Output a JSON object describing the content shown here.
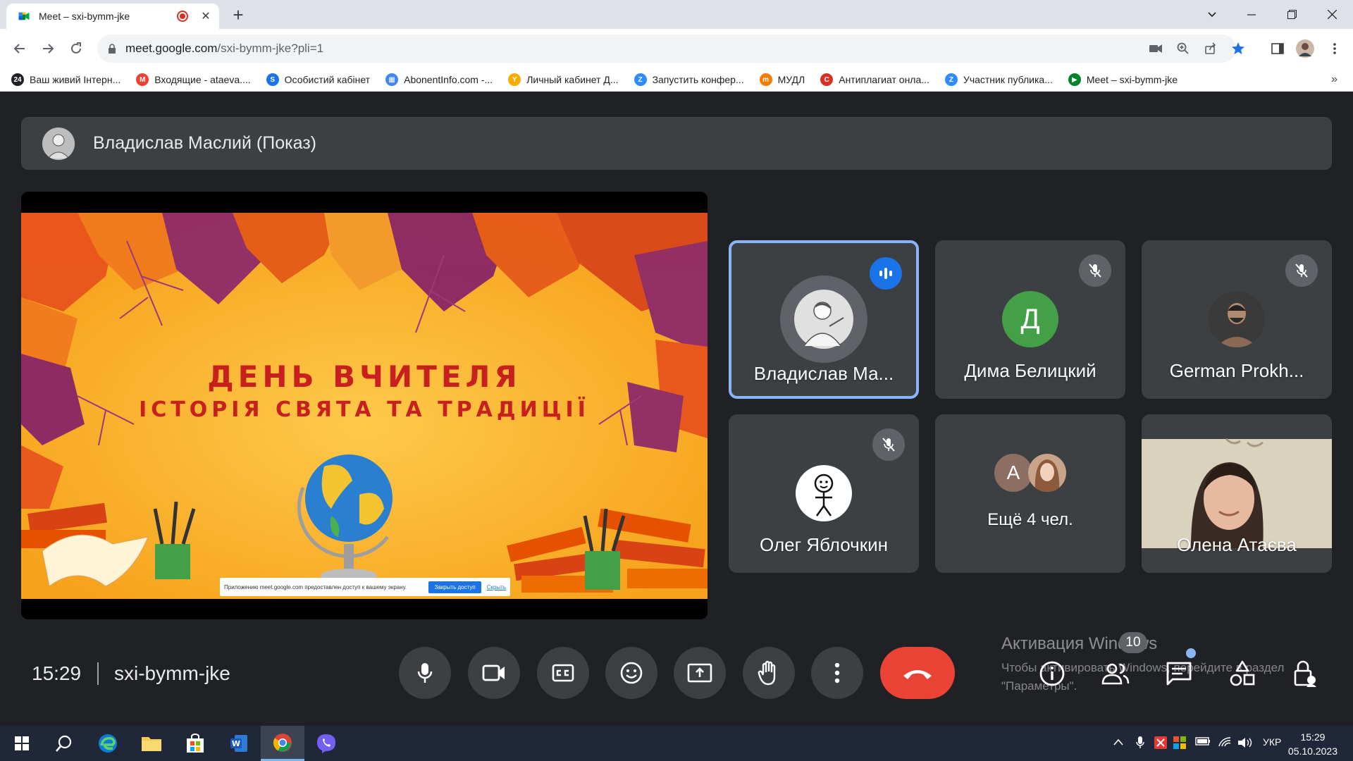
{
  "browser": {
    "tab": {
      "title": "Meet – sxi-bymm-jke",
      "close": "✕"
    },
    "new_tab": "+",
    "url": {
      "host": "meet.google.com",
      "path": "/sxi-bymm-jke?pli=1"
    },
    "bookmarks": [
      {
        "label": "Ваш живий Інтерн...",
        "icon_color": "#202124",
        "glyph": "24"
      },
      {
        "label": "Входящие - ataeva....",
        "icon_color": "#ea4335",
        "glyph": "M"
      },
      {
        "label": "Особистий кабінет",
        "icon_color": "#1a73e8",
        "glyph": "S"
      },
      {
        "label": "AbonentInfo.com -...",
        "icon_color": "#4285f4",
        "glyph": "▦"
      },
      {
        "label": "Личный кабинет Д...",
        "icon_color": "#f9ab00",
        "glyph": "Y"
      },
      {
        "label": "Запустить конфер...",
        "icon_color": "#2d8cff",
        "glyph": "Z"
      },
      {
        "label": "МУДЛ",
        "icon_color": "#f57c00",
        "glyph": "m"
      },
      {
        "label": "Антиплагиат онла...",
        "icon_color": "#d93025",
        "glyph": "C"
      },
      {
        "label": "Участник публика...",
        "icon_color": "#2d8cff",
        "glyph": "Z"
      },
      {
        "label": "Meet – sxi-bymm-jke",
        "icon_color": "#00832d",
        "glyph": "▶"
      }
    ],
    "bookmarks_more": "»"
  },
  "meet": {
    "presenter": "Владислав Маслий (Показ)",
    "slide": {
      "title": "ДЕНЬ ВЧИТЕЛЯ",
      "subtitle": "ІСТОРІЯ СВЯТА ТА ТРАДИЦІЇ",
      "share_notice": "Приложению meet.google.com предоставлен доступ к вашему экрану.",
      "share_stop": "Закрыть доступ",
      "share_hide": "Скрыть"
    },
    "participants": [
      {
        "name": "Владислав Ма...",
        "speaking": true
      },
      {
        "name": "Дима Белицкий",
        "initial": "Д",
        "color": "#43a047",
        "muted": true
      },
      {
        "name": "German Prokh...",
        "muted": true
      },
      {
        "name": "Олег Яблочкин",
        "muted": true
      },
      {
        "name": "Ещё 4 чел.",
        "initial": "A",
        "color": "#8d6e63"
      },
      {
        "name": "Олена Атаєва"
      }
    ],
    "time": "15:29",
    "code": "sxi-bymm-jke",
    "people_count": "10",
    "watermark": {
      "title": "Активация Windows",
      "line1": "Чтобы активировать Windows, перейдите в раздел",
      "line2": "\"Параметры\"."
    },
    "colors": {
      "end_call": "#ea4335",
      "active_border": "#8ab4f8",
      "speaking": "#1a73e8"
    }
  },
  "taskbar": {
    "language": "УКР",
    "time": "15:29",
    "date": "05.10.2023"
  }
}
